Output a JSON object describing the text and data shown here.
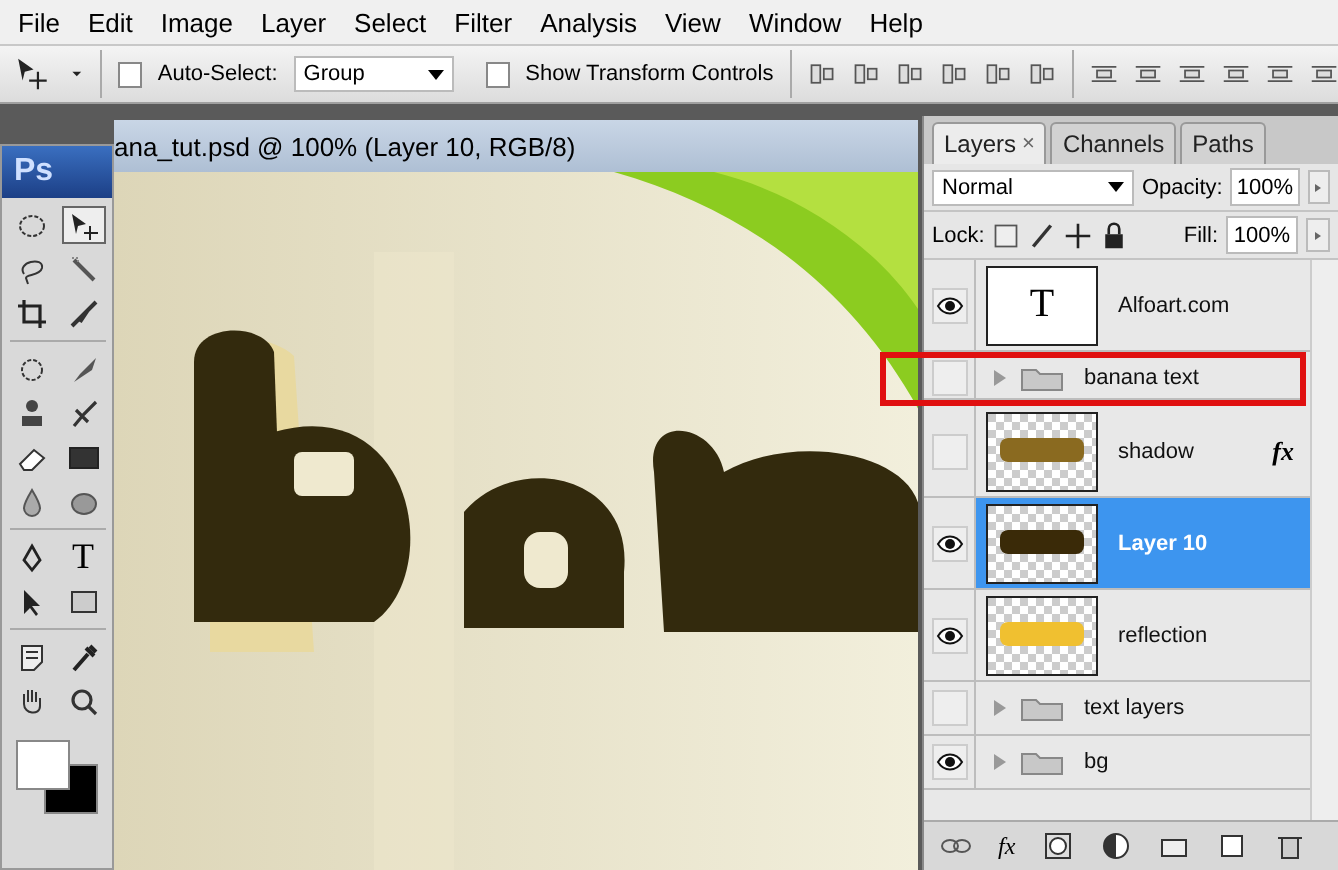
{
  "menu": [
    "File",
    "Edit",
    "Image",
    "Layer",
    "Select",
    "Filter",
    "Analysis",
    "View",
    "Window",
    "Help"
  ],
  "options_bar": {
    "auto_select": {
      "label": "Auto-Select:",
      "checked": false
    },
    "auto_select_value": "Group",
    "transform": {
      "label": "Show Transform Controls",
      "checked": false
    }
  },
  "toolbox": {
    "logo": "Ps",
    "type_glyph": "T"
  },
  "document": {
    "title": "ana_tut.psd @ 100% (Layer 10, RGB/8)"
  },
  "layers_panel": {
    "tabs": [
      {
        "label": "Layers",
        "selected": true,
        "close": "×"
      },
      {
        "label": "Channels",
        "selected": false
      },
      {
        "label": "Paths",
        "selected": false
      }
    ],
    "blend_mode": "Normal",
    "opacity_label": "Opacity:",
    "opacity": "100%",
    "lock_label": "Lock:",
    "fill_label": "Fill:",
    "fill": "100%",
    "footer_fx": "fx",
    "layers": [
      {
        "kind": "text",
        "name": "Alfoart.com",
        "thumb_glyph": "T",
        "visible": true,
        "selected": false,
        "outlined": false
      },
      {
        "kind": "group",
        "name": "banana text",
        "visible": false,
        "selected": false,
        "outlined": true
      },
      {
        "name": "shadow",
        "visible": false,
        "selected": false,
        "outlined": false,
        "fx": "fx"
      },
      {
        "name": "Layer 10",
        "visible": true,
        "selected": true,
        "outlined": false
      },
      {
        "name": "reflection",
        "visible": true,
        "selected": false,
        "outlined": false
      },
      {
        "kind": "group",
        "name": "text layers",
        "visible": false,
        "selected": false,
        "outlined": false
      },
      {
        "kind": "group",
        "name": "bg",
        "visible": true,
        "selected": false,
        "outlined": false
      }
    ]
  }
}
